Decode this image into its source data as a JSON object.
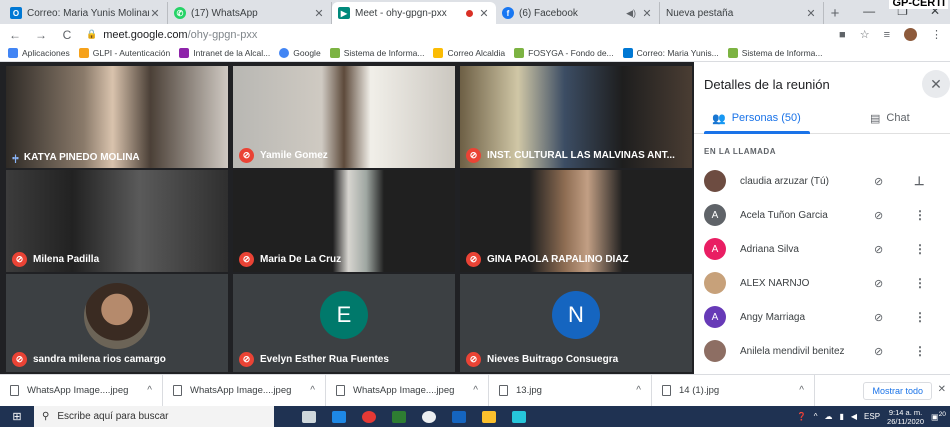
{
  "corner_label": "GP-CERTI",
  "tabs": [
    {
      "title": "Correo: Maria Yunis Molinares",
      "favicon_color": "#0078d4",
      "active": false
    },
    {
      "title": "(17) WhatsApp",
      "favicon_color": "#25d366",
      "active": false
    },
    {
      "title": "Meet - ohy-gpgn-pxx",
      "favicon_color": "#00897b",
      "active": true
    },
    {
      "title": "(6) Facebook",
      "favicon_color": "#1877f2",
      "active": false
    },
    {
      "title": "Nueva pestaña",
      "favicon_color": "",
      "active": false
    }
  ],
  "address": {
    "host": "meet.google.com",
    "path": "/ohy-gpgn-pxx"
  },
  "bookmarks": [
    {
      "label": "Aplicaciones",
      "color": "#4285f4"
    },
    {
      "label": "GLPI - Autenticación",
      "color": "#f6a21b"
    },
    {
      "label": "Intranet de la Alcal...",
      "color": "#8e24aa"
    },
    {
      "label": "Google",
      "color": "#4285f4"
    },
    {
      "label": "Sistema de Informa...",
      "color": "#7cb342"
    },
    {
      "label": "Correo Alcaldia",
      "color": "#fbbc04"
    },
    {
      "label": "FOSYGA - Fondo de...",
      "color": "#7cb342"
    },
    {
      "label": "Correo: Maria Yunis...",
      "color": "#0078d4"
    },
    {
      "label": "Sistema de Informa...",
      "color": "#7cb342"
    }
  ],
  "tiles": [
    {
      "name": "KATYA PINEDO MOLINA",
      "state": "speaking"
    },
    {
      "name": "Yamile Gomez",
      "state": "muted"
    },
    {
      "name": "INST. CULTURAL LAS MALVINAS ANT...",
      "state": "muted"
    },
    {
      "name": "Milena Padilla",
      "state": "muted"
    },
    {
      "name": "Maria De La Cruz",
      "state": "muted"
    },
    {
      "name": "GINA PAOLA RAPALINO DIAZ",
      "state": "muted"
    },
    {
      "name": "sandra milena rios camargo",
      "state": "muted"
    },
    {
      "name": "Evelyn Esther Rua Fuentes",
      "state": "muted",
      "initial": "E"
    },
    {
      "name": "Nieves Buitrago Consuegra",
      "state": "muted",
      "initial": "N"
    }
  ],
  "panel": {
    "title": "Detalles de la reunión",
    "people_tab": "Personas (50)",
    "chat_tab": "Chat",
    "section": "EN LA LLAMADA",
    "people": [
      {
        "name": "claudia arzuzar (Tú)",
        "initial": "",
        "color": "#6d4c41"
      },
      {
        "name": "Acela Tuñon Garcia",
        "initial": "A",
        "color": "#5f6368"
      },
      {
        "name": "Adriana Silva",
        "initial": "A",
        "color": "#e91e63"
      },
      {
        "name": "ALEX NARNJO",
        "initial": "",
        "color": "#c7a17a"
      },
      {
        "name": "Angy Marriaga",
        "initial": "A",
        "color": "#673ab7"
      },
      {
        "name": "Anilela mendivil benitez",
        "initial": "",
        "color": "#8d6e63"
      }
    ]
  },
  "downloads": [
    {
      "name": "WhatsApp Image....jpeg"
    },
    {
      "name": "WhatsApp Image....jpeg"
    },
    {
      "name": "WhatsApp Image....jpeg"
    },
    {
      "name": "13.jpg"
    },
    {
      "name": "14 (1).jpg"
    }
  ],
  "show_all": "Mostrar todo",
  "taskbar": {
    "search_placeholder": "Escribe aquí para buscar",
    "lang": "ESP",
    "time": "9:14 a. m.",
    "date": "26/11/2020",
    "notif": "20"
  }
}
